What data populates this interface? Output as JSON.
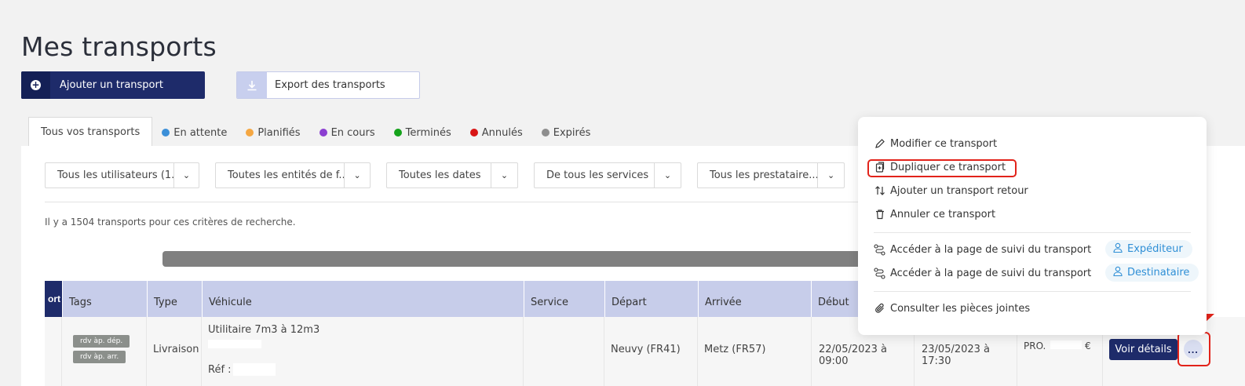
{
  "page": {
    "title": "Mes transports"
  },
  "toolbar": {
    "add_label": "Ajouter un transport",
    "export_label": "Export des transports"
  },
  "tabs": [
    {
      "label": "Tous vos transports",
      "color": ""
    },
    {
      "label": "En attente",
      "color": "#3b8fd8"
    },
    {
      "label": "Planifiés",
      "color": "#f5a742"
    },
    {
      "label": "En cours",
      "color": "#8b3fd1"
    },
    {
      "label": "Terminés",
      "color": "#16a31c"
    },
    {
      "label": "Annulés",
      "color": "#d81515"
    },
    {
      "label": "Expirés",
      "color": "#8e8e8e"
    }
  ],
  "filters": [
    "Tous les utilisateurs (1...",
    "Toutes les entités de f...",
    "Toutes les dates",
    "De tous les services",
    "Tous les prestataire..."
  ],
  "result_count": "Il y a 1504 transports pour ces critères de recherche.",
  "table": {
    "truncated_header": "ort",
    "headers": [
      "Tags",
      "Type",
      "Véhicule",
      "Service",
      "Départ",
      "Arrivée",
      "Début"
    ],
    "row": {
      "tags": [
        "rdv àp. dép.",
        "rdv àp. arr."
      ],
      "type": "Livraison",
      "vehicle": "Utilitaire 7m3 à 12m3",
      "ref_label": "Réf :",
      "service": "",
      "depart": "Neuvy (FR41)",
      "arrivee": "Metz (FR57)",
      "debut": "22/05/2023 à 09:00",
      "fin": "23/05/2023 à 17:30",
      "price_prefix": "PRO.",
      "price_suffix": "€",
      "details_label": "Voir détails",
      "more_label": "..."
    }
  },
  "context_menu": {
    "items": [
      {
        "label": "Modifier ce transport",
        "icon": "pencil-icon"
      },
      {
        "label": "Dupliquer ce transport",
        "icon": "duplicate-icon"
      },
      {
        "label": "Ajouter un transport retour",
        "icon": "swap-arrows-icon"
      },
      {
        "label": "Annuler ce transport",
        "icon": "trash-icon"
      }
    ],
    "tracking": [
      {
        "label": "Accéder à la page de suivi du transport",
        "badge": "Expéditeur"
      },
      {
        "label": "Accéder à la page de suivi du transport",
        "badge": "Destinataire"
      }
    ],
    "attachments_label": "Consulter les pièces jointes"
  },
  "colors": {
    "primary": "#1e2b6a",
    "table_header": "#c7cdea",
    "highlight": "#e2231a",
    "badge_blue": "#2f8fd6"
  }
}
